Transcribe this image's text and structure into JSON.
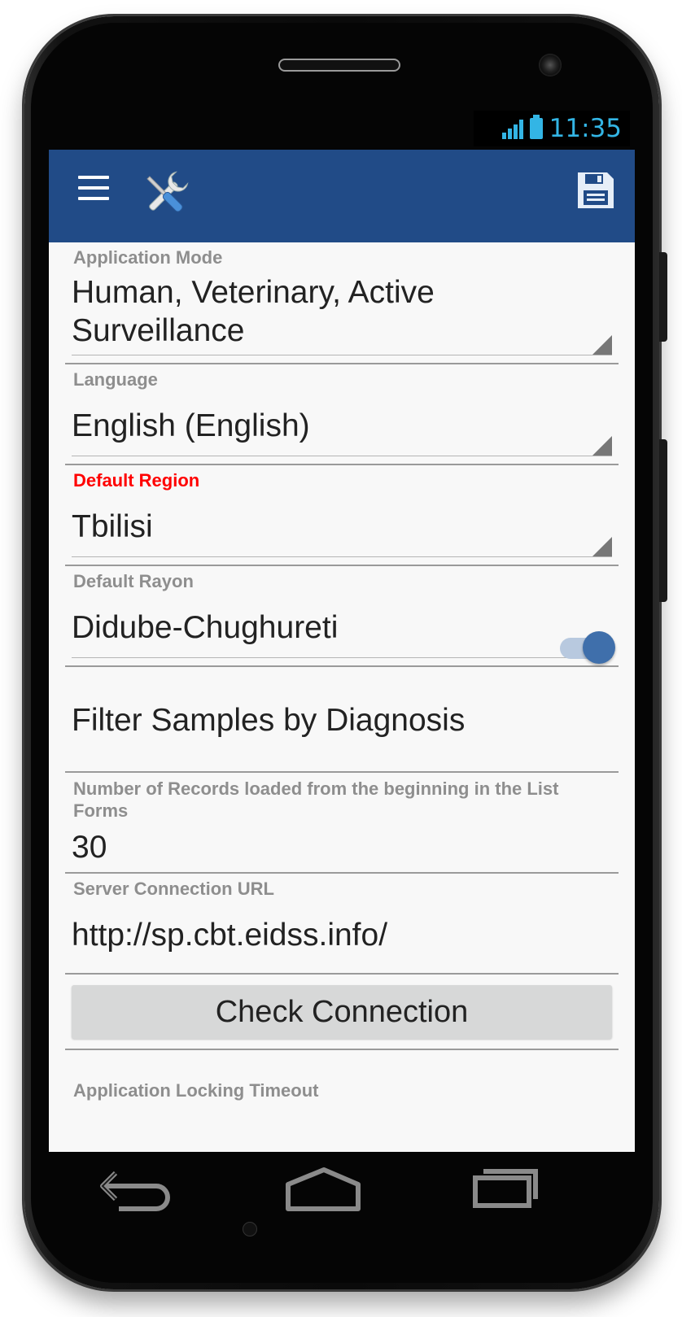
{
  "status_bar": {
    "time": "11:35",
    "icons": [
      "signal-icon",
      "battery-icon"
    ]
  },
  "app_bar": {
    "color": "#214b87",
    "left_icons": [
      "menu-icon",
      "tools-icon"
    ],
    "right_icons": [
      "save-icon"
    ]
  },
  "settings": {
    "application_mode": {
      "label": "Application Mode",
      "value": "Human, Veterinary, Active Surveillance"
    },
    "language": {
      "label": "Language",
      "value": "English (English)"
    },
    "default_region": {
      "label": "Default Region",
      "value": "Tbilisi",
      "label_color": "#ff0000"
    },
    "default_rayon": {
      "label": "Default Rayon",
      "value": "Didube-Chughureti"
    },
    "filter_samples": {
      "label": "Filter Samples by Diagnosis",
      "enabled": true
    },
    "records_loaded": {
      "label": "Number of Records loaded from the beginning in the List Forms",
      "value": "30"
    },
    "server_url": {
      "label": "Server Connection URL",
      "value": "http://sp.cbt.eidss.info/"
    },
    "check_connection": {
      "label": "Check Connection"
    },
    "locking_timeout": {
      "label": "Application Locking Timeout"
    }
  },
  "nav_bar": {
    "icons": [
      "back-icon",
      "home-icon",
      "recent-apps-icon"
    ]
  }
}
